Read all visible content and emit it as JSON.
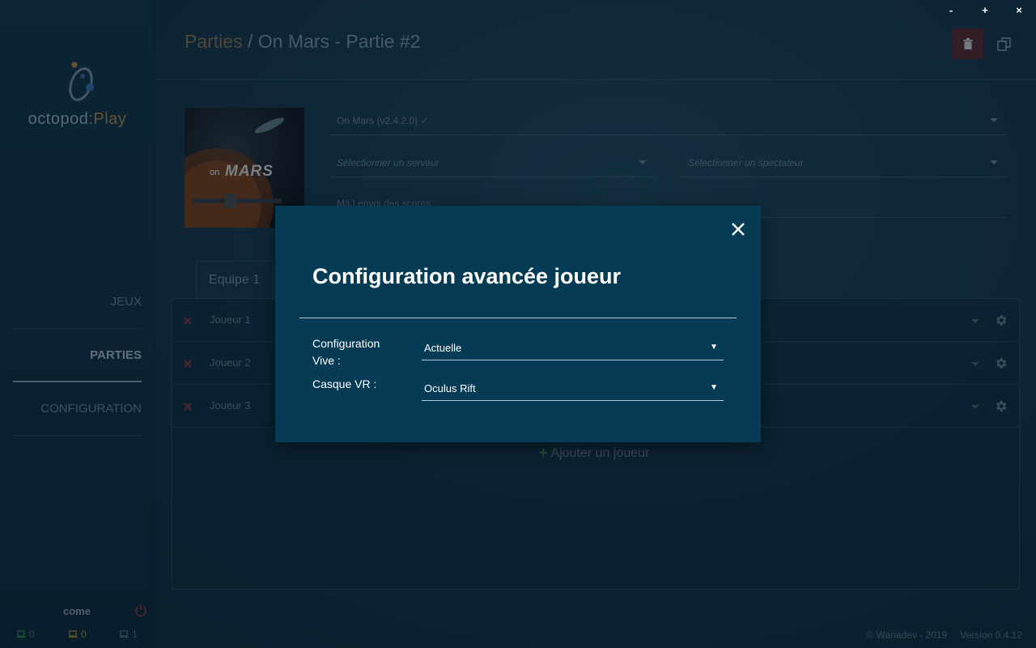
{
  "window_controls": {
    "minimize": "-",
    "maximize": "+",
    "close": "×"
  },
  "app": {
    "logo_text_main": "octopod",
    "logo_text_accent": ":Play"
  },
  "sidebar": {
    "items": [
      {
        "label": "JEUX"
      },
      {
        "label": "PARTIES"
      },
      {
        "label": "CONFIGURATION"
      }
    ],
    "user": "come",
    "status": [
      {
        "count": "0",
        "color": "#2e8b57"
      },
      {
        "count": "0",
        "color": "#b8962e"
      },
      {
        "count": "1",
        "color": "#5e7888"
      }
    ]
  },
  "header": {
    "breadcrumb_parent": "Parties",
    "separator": " / ",
    "title": "On Mars - Partie #2"
  },
  "game": {
    "thumb_text_small": "on",
    "thumb_text_big": "MARS",
    "version_select": "On Mars (v2.4.2.0) ✓",
    "server_placeholder": "Sélectionner un serveur",
    "spectator_placeholder": "Sélectionner un spectateur",
    "scores_label": "MàJ envoi des scores"
  },
  "teams": {
    "active_tab": "Equipe 1",
    "players": [
      {
        "name": "Joueur 1"
      },
      {
        "name": "Joueur 2"
      },
      {
        "name": "Joueur 3"
      }
    ],
    "add_player_label": "Ajouter un joueur"
  },
  "footer": {
    "copyright": "© Wanadev - 2019",
    "version": "Version 0.4.12"
  },
  "modal": {
    "title": "Configuration avancée joueur",
    "fields": [
      {
        "label": "Configuration Vive :",
        "value": "Actuelle"
      },
      {
        "label": "Casque VR :",
        "value": "Oculus Rift"
      }
    ]
  }
}
